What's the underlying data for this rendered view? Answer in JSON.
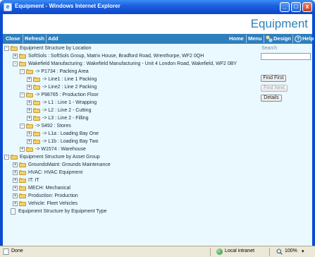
{
  "window": {
    "title": "Equipment - Windows Internet Explorer",
    "minimize_glyph": "_",
    "maximize_glyph": "□",
    "close_glyph": "x"
  },
  "app": {
    "title": "Equipment"
  },
  "toolbar": {
    "close_label": "Close",
    "refresh_label": "Refresh",
    "add_label": "Add",
    "home_label": "Home",
    "menu_label": "Menu",
    "design_label": "Design",
    "help_label": "Help"
  },
  "search": {
    "label": "Search",
    "value": "",
    "find_first_label": "Find First",
    "find_next_label": "Find Next",
    "details_label": "Details"
  },
  "tree": [
    {
      "label": "Equipment Structure by Location",
      "expander": "-",
      "icon": "folder-icon"
    },
    {
      "label": "SoftSols : SoftSols Group, Matrix House, Bradford Road, Wrenthorpe, WF2 0QH",
      "expander": "+",
      "icon": "folder-icon"
    },
    {
      "label": "Wakefield Manufacturing : Wakefield Manufacturing - Unit 4 London Road, Wakefield, WF2 0BY",
      "expander": "-",
      "icon": "folder-icon"
    },
    {
      "label": "-> P1734 : Packing Area",
      "expander": "-",
      "icon": "folder-icon"
    },
    {
      "label": "-> Line1 : Line 1 Packing",
      "expander": "+",
      "icon": "folder-icon"
    },
    {
      "label": "-> Line2 : Line 2 Packing",
      "expander": "+",
      "icon": "folder-icon"
    },
    {
      "label": "-> P98765 : Production Floor",
      "expander": "-",
      "icon": "folder-icon"
    },
    {
      "label": "-> L1 : Line 1 - Wrapping",
      "expander": "+",
      "icon": "folder-icon"
    },
    {
      "label": "-> L2 : Line 2 - Cutting",
      "expander": "+",
      "icon": "folder-icon"
    },
    {
      "label": "-> L3 : Line 2 - Filling",
      "expander": "+",
      "icon": "folder-icon"
    },
    {
      "label": "-> S492 : Stores",
      "expander": "-",
      "icon": "folder-icon"
    },
    {
      "label": "-> L1a : Loading Bay One",
      "expander": "+",
      "icon": "folder-icon"
    },
    {
      "label": "-> L1b : Loading Bay Two",
      "expander": "+",
      "icon": "folder-icon"
    },
    {
      "label": "-> W1574 : Warehouse",
      "expander": "+",
      "icon": "folder-icon"
    },
    {
      "label": "Equipment Structure by Asset Group",
      "expander": "-",
      "icon": "folder-icon"
    },
    {
      "label": "GroundsMaint: Grounds Maintenance",
      "expander": "+",
      "icon": "folder-icon"
    },
    {
      "label": "HVAC: HVAC Equipment",
      "expander": "+",
      "icon": "folder-icon"
    },
    {
      "label": "IT: IT",
      "expander": "+",
      "icon": "folder-icon"
    },
    {
      "label": "MECH: Mechanical",
      "expander": "+",
      "icon": "folder-icon"
    },
    {
      "label": "Production: Production",
      "expander": "+",
      "icon": "folder-icon"
    },
    {
      "label": "Vehicle: Fleet Vehicles",
      "expander": "+",
      "icon": "folder-icon"
    },
    {
      "label": "Equipment Structure by Equipment Type",
      "expander": "",
      "icon": "document-icon"
    }
  ],
  "status": {
    "text": "Done",
    "zone": "Local intranet",
    "zoom": "100%"
  },
  "colors": {
    "toolbar": "#2e7fbd",
    "app_title": "#2a7fb8",
    "content_bg": "#eaf9ff"
  }
}
